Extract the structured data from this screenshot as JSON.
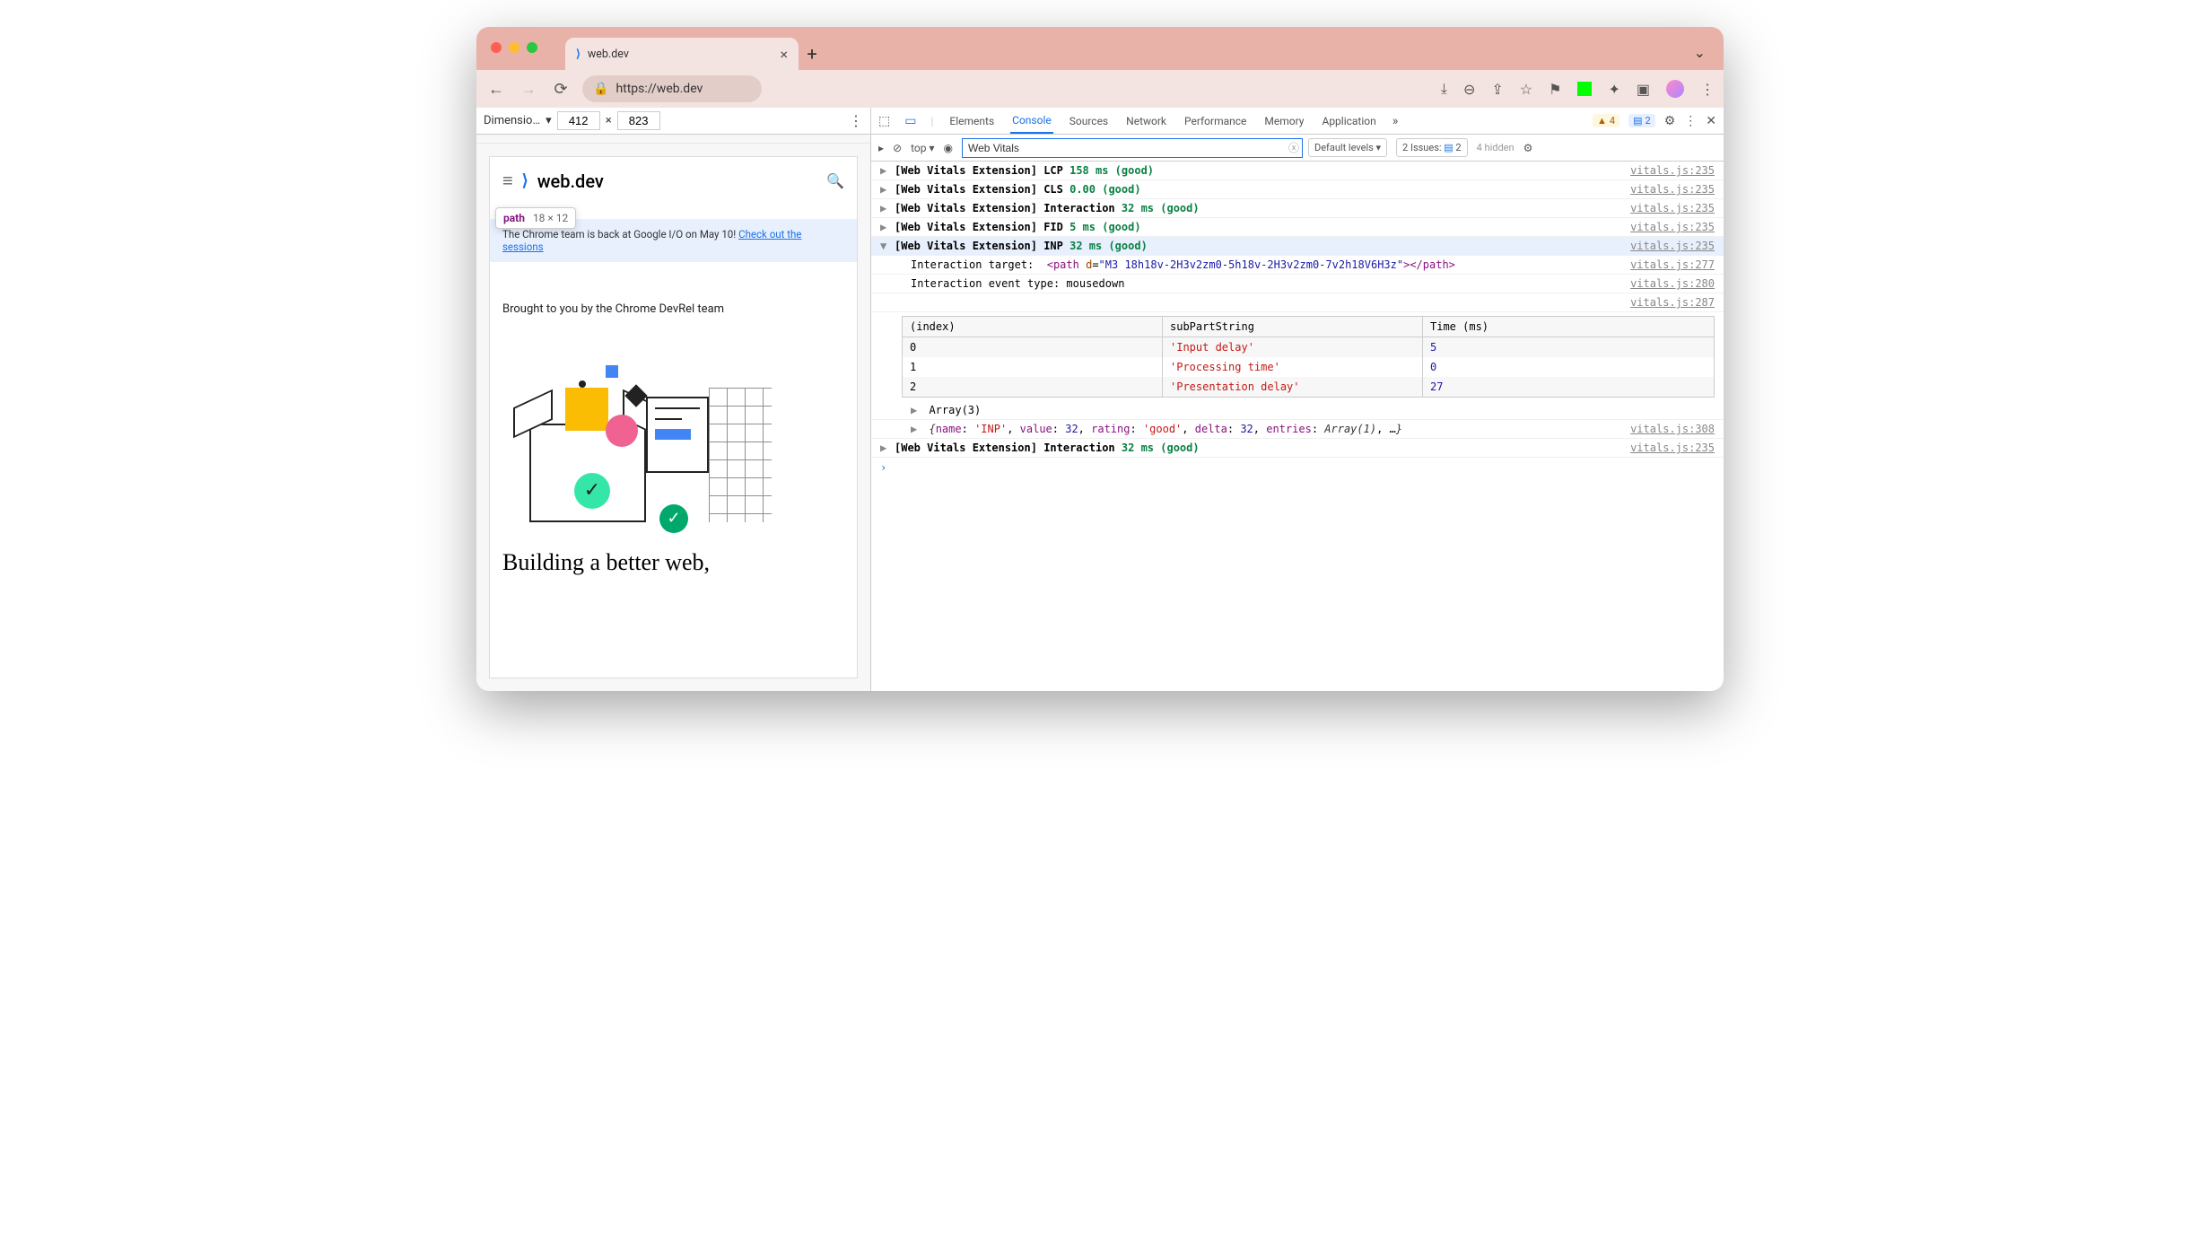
{
  "browser": {
    "tab_title": "web.dev",
    "url": "https://web.dev",
    "url_scheme_icon": "lock"
  },
  "device_toolbar": {
    "label": "Dimensio…",
    "width": "412",
    "height": "823",
    "separator": "×"
  },
  "tooltip": {
    "tag": "path",
    "dimensions": "18 × 12"
  },
  "page": {
    "site_title": "web.dev",
    "banner_text": "The Chrome team is back at Google I/O on May 10! ",
    "banner_link": "Check out the sessions",
    "brought": "Brought to you by the Chrome DevRel team",
    "headline": "Building a better web,"
  },
  "devtools": {
    "tabs": [
      "Elements",
      "Console",
      "Sources",
      "Network",
      "Performance",
      "Memory",
      "Application"
    ],
    "active_tab": "Console",
    "warn_count": "4",
    "info_count": "2",
    "console": {
      "context": "top",
      "filter": "Web Vitals",
      "levels": "Default levels",
      "issues_label": "2 Issues:",
      "issues_count": "2",
      "hidden": "4 hidden"
    }
  },
  "logs": [
    {
      "prefix": "[Web Vitals Extension]",
      "metric": "LCP",
      "value": "158 ms (good)",
      "src": "vitals.js:235",
      "expanded": false
    },
    {
      "prefix": "[Web Vitals Extension]",
      "metric": "CLS",
      "value": "0.00 (good)",
      "src": "vitals.js:235",
      "expanded": false
    },
    {
      "prefix": "[Web Vitals Extension]",
      "metric": "Interaction",
      "value": "32 ms (good)",
      "src": "vitals.js:235",
      "expanded": false
    },
    {
      "prefix": "[Web Vitals Extension]",
      "metric": "FID",
      "value": "5 ms (good)",
      "src": "vitals.js:235",
      "expanded": false
    },
    {
      "prefix": "[Web Vitals Extension]",
      "metric": "INP",
      "value": "32 ms (good)",
      "src": "vitals.js:235",
      "expanded": true
    }
  ],
  "expanded": {
    "target_label": "Interaction target:",
    "target_elem": "<path d=\"M3 18h18v-2H3v2zm0-5h18v-2H3v2zm0-7v2h18V6H3z\"></path>",
    "target_src": "vitals.js:277",
    "event_label": "Interaction event type:",
    "event_value": "mousedown",
    "event_src": "vitals.js:280",
    "table_src": "vitals.js:287",
    "table_headers": [
      "(index)",
      "subPartString",
      "Time (ms)"
    ],
    "table_rows": [
      {
        "i": "0",
        "part": "'Input delay'",
        "ms": "5"
      },
      {
        "i": "1",
        "part": "'Processing time'",
        "ms": "0"
      },
      {
        "i": "2",
        "part": "'Presentation delay'",
        "ms": "27"
      }
    ],
    "array_label": "Array(3)",
    "obj_text": "{name: 'INP', value: 32, rating: 'good', delta: 32, entries: Array(1), …}",
    "obj_src": "vitals.js:308"
  },
  "final_log": {
    "prefix": "[Web Vitals Extension]",
    "metric": "Interaction",
    "value": "32 ms (good)",
    "src": "vitals.js:235"
  }
}
